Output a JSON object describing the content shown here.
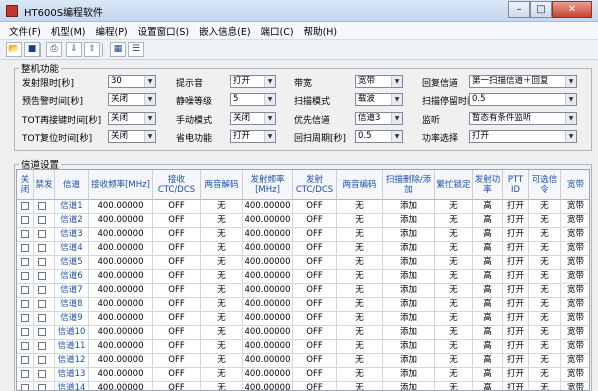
{
  "window": {
    "title": "HT600S编程软件",
    "minimize": "–",
    "maximize": "□",
    "close": "✕"
  },
  "menu": [
    "文件(F)",
    "机型(M)",
    "编程(P)",
    "设置窗口(S)",
    "嵌入信息(E)",
    "端口(C)",
    "帮助(H)"
  ],
  "toolbar": [
    "open-icon",
    "save-icon",
    "print-icon",
    "read-icon",
    "write-icon",
    "grid-view-icon",
    "list-view-icon"
  ],
  "device_settings": {
    "title": "整机功能",
    "fields": [
      {
        "label": "发射限时[秒]",
        "value": "30"
      },
      {
        "label": "预告警时间[秒]",
        "value": "关闭"
      },
      {
        "label": "TOT再接键时间[秒]",
        "value": "关闭"
      },
      {
        "label": "TOT复位时间[秒]",
        "value": "关闭"
      },
      {
        "label": "提示音",
        "value": "打开"
      },
      {
        "label": "静噪等级",
        "value": "5"
      },
      {
        "label": "手动模式",
        "value": "关闭"
      },
      {
        "label": "省电功能",
        "value": "打开"
      },
      {
        "label": "带宽",
        "value": "宽带"
      },
      {
        "label": "扫描模式",
        "value": "载波"
      },
      {
        "label": "优先信道",
        "value": "信道3"
      },
      {
        "label": "回扫周期[秒]",
        "value": "0.5"
      },
      {
        "label": "回复信道",
        "value": "第一扫描信道＋回复"
      },
      {
        "label": "扫描停留时间[秒]",
        "value": "0.5"
      },
      {
        "label": "监听",
        "value": "暂态有条件监听"
      },
      {
        "label": "功率选择",
        "value": "打开"
      }
    ]
  },
  "channel_settings": {
    "title": "信道设置",
    "columns": [
      "关闭",
      "禁发",
      "信道",
      "接收频率[MHz]",
      "接收CTC/DCS",
      "两音解码",
      "发射频率[MHz]",
      "发射CTC/DCS",
      "两音编码",
      "扫描删除/添加",
      "繁忙锁定",
      "发射功率",
      "PTT ID",
      "可选信令",
      "宽带"
    ],
    "rows": [
      {
        "name": "信道1",
        "rx": "400.00000",
        "rx_ctc": "OFF",
        "dec": "无",
        "tx": "400.00000",
        "tx_ctc": "OFF",
        "enc": "无",
        "scan": "添加",
        "busy": "无",
        "power": "高",
        "ptt": "打开",
        "sig": "无",
        "bw": "宽带"
      },
      {
        "name": "信道2",
        "rx": "400.00000",
        "rx_ctc": "OFF",
        "dec": "无",
        "tx": "400.00000",
        "tx_ctc": "OFF",
        "enc": "无",
        "scan": "添加",
        "busy": "无",
        "power": "高",
        "ptt": "打开",
        "sig": "无",
        "bw": "宽带"
      },
      {
        "name": "信道3",
        "rx": "400.00000",
        "rx_ctc": "OFF",
        "dec": "无",
        "tx": "400.00000",
        "tx_ctc": "OFF",
        "enc": "无",
        "scan": "添加",
        "busy": "无",
        "power": "高",
        "ptt": "打开",
        "sig": "无",
        "bw": "宽带"
      },
      {
        "name": "信道4",
        "rx": "400.00000",
        "rx_ctc": "OFF",
        "dec": "无",
        "tx": "400.00000",
        "tx_ctc": "OFF",
        "enc": "无",
        "scan": "添加",
        "busy": "无",
        "power": "高",
        "ptt": "打开",
        "sig": "无",
        "bw": "宽带"
      },
      {
        "name": "信道5",
        "rx": "400.00000",
        "rx_ctc": "OFF",
        "dec": "无",
        "tx": "400.00000",
        "tx_ctc": "OFF",
        "enc": "无",
        "scan": "添加",
        "busy": "无",
        "power": "高",
        "ptt": "打开",
        "sig": "无",
        "bw": "宽带"
      },
      {
        "name": "信道6",
        "rx": "400.00000",
        "rx_ctc": "OFF",
        "dec": "无",
        "tx": "400.00000",
        "tx_ctc": "OFF",
        "enc": "无",
        "scan": "添加",
        "busy": "无",
        "power": "高",
        "ptt": "打开",
        "sig": "无",
        "bw": "宽带"
      },
      {
        "name": "信道7",
        "rx": "400.00000",
        "rx_ctc": "OFF",
        "dec": "无",
        "tx": "400.00000",
        "tx_ctc": "OFF",
        "enc": "无",
        "scan": "添加",
        "busy": "无",
        "power": "高",
        "ptt": "打开",
        "sig": "无",
        "bw": "宽带"
      },
      {
        "name": "信道8",
        "rx": "400.00000",
        "rx_ctc": "OFF",
        "dec": "无",
        "tx": "400.00000",
        "tx_ctc": "OFF",
        "enc": "无",
        "scan": "添加",
        "busy": "无",
        "power": "高",
        "ptt": "打开",
        "sig": "无",
        "bw": "宽带"
      },
      {
        "name": "信道9",
        "rx": "400.00000",
        "rx_ctc": "OFF",
        "dec": "无",
        "tx": "400.00000",
        "tx_ctc": "OFF",
        "enc": "无",
        "scan": "添加",
        "busy": "无",
        "power": "高",
        "ptt": "打开",
        "sig": "无",
        "bw": "宽带"
      },
      {
        "name": "信道10",
        "rx": "400.00000",
        "rx_ctc": "OFF",
        "dec": "无",
        "tx": "400.00000",
        "tx_ctc": "OFF",
        "enc": "无",
        "scan": "添加",
        "busy": "无",
        "power": "高",
        "ptt": "打开",
        "sig": "无",
        "bw": "宽带"
      },
      {
        "name": "信道11",
        "rx": "400.00000",
        "rx_ctc": "OFF",
        "dec": "无",
        "tx": "400.00000",
        "tx_ctc": "OFF",
        "enc": "无",
        "scan": "添加",
        "busy": "无",
        "power": "高",
        "ptt": "打开",
        "sig": "无",
        "bw": "宽带"
      },
      {
        "name": "信道12",
        "rx": "400.00000",
        "rx_ctc": "OFF",
        "dec": "无",
        "tx": "400.00000",
        "tx_ctc": "OFF",
        "enc": "无",
        "scan": "添加",
        "busy": "无",
        "power": "高",
        "ptt": "打开",
        "sig": "无",
        "bw": "宽带"
      },
      {
        "name": "信道13",
        "rx": "400.00000",
        "rx_ctc": "OFF",
        "dec": "无",
        "tx": "400.00000",
        "tx_ctc": "OFF",
        "enc": "无",
        "scan": "添加",
        "busy": "无",
        "power": "高",
        "ptt": "打开",
        "sig": "无",
        "bw": "宽带"
      },
      {
        "name": "信道14",
        "rx": "400.00000",
        "rx_ctc": "OFF",
        "dec": "无",
        "tx": "400.00000",
        "tx_ctc": "OFF",
        "enc": "无",
        "scan": "添加",
        "busy": "无",
        "power": "高",
        "ptt": "打开",
        "sig": "无",
        "bw": "宽带"
      }
    ]
  }
}
